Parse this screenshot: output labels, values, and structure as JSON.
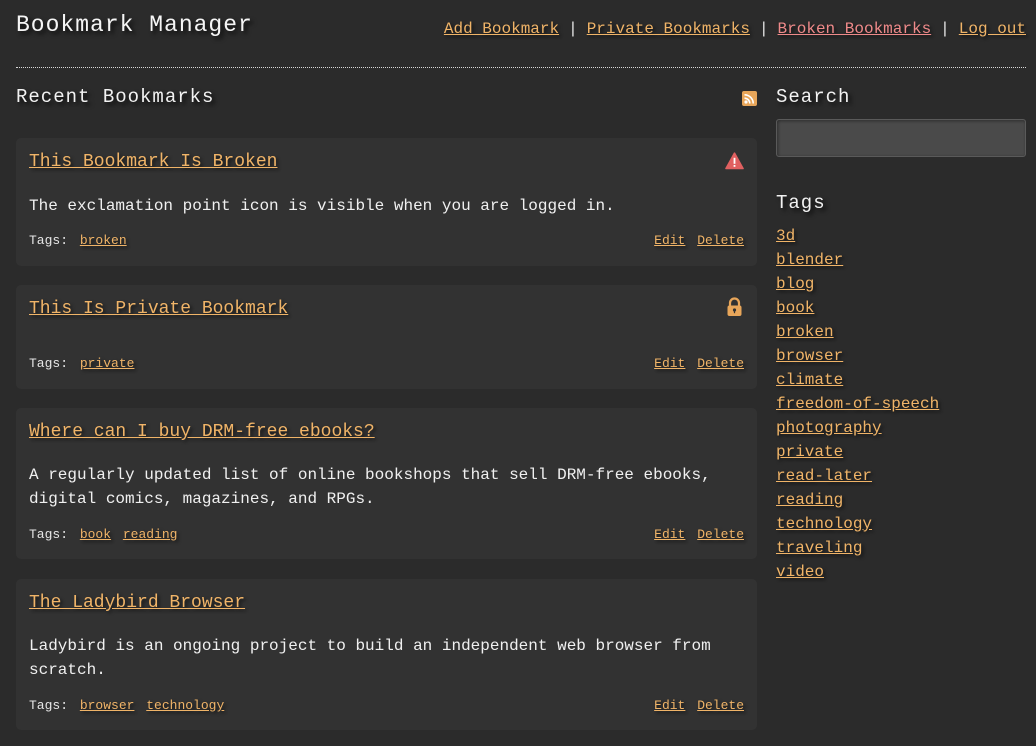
{
  "header": {
    "title": "Bookmark Manager",
    "nav": {
      "add": "Add Bookmark",
      "private": "Private Bookmarks",
      "broken": "Broken Bookmarks",
      "logout": "Log out",
      "separator": "|"
    }
  },
  "main": {
    "section_title": "Recent Bookmarks",
    "rss_icon": "rss-feed-icon",
    "tags_prefix": "Tags:",
    "edit_label": "Edit",
    "delete_label": "Delete",
    "bookmarks": [
      {
        "title": "This Bookmark Is Broken",
        "description": "The exclamation point icon is visible when you are logged in.",
        "tags": [
          "broken"
        ],
        "icon": "warning-icon"
      },
      {
        "title": "This Is Private Bookmark",
        "description": "",
        "tags": [
          "private"
        ],
        "icon": "lock-icon"
      },
      {
        "title": "Where can I buy DRM-free ebooks?",
        "description": "A regularly updated list of online bookshops that sell DRM-free ebooks, digital comics, magazines, and RPGs.",
        "tags": [
          "book",
          "reading"
        ],
        "icon": ""
      },
      {
        "title": "The Ladybird Browser",
        "description": "Ladybird is an ongoing project to build an independent web browser from scratch.",
        "tags": [
          "browser",
          "technology"
        ],
        "icon": ""
      }
    ]
  },
  "sidebar": {
    "search_title": "Search",
    "search_placeholder": "",
    "tags_title": "Tags",
    "tags": [
      "3d",
      "blender",
      "blog",
      "book",
      "broken",
      "browser",
      "climate",
      "freedom-of-speech",
      "photography",
      "private",
      "read-later",
      "reading",
      "technology",
      "traveling",
      "video"
    ]
  },
  "colors": {
    "background": "#2b2b2b",
    "card": "#323232",
    "link": "#f0b468",
    "broken_link": "#ef8a8a",
    "warning": "#e06060",
    "lock": "#e8a65a"
  }
}
